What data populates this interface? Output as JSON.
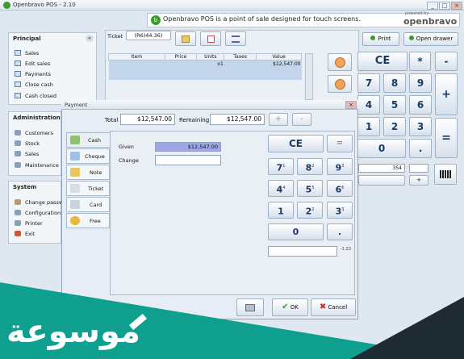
{
  "window": {
    "title": "Openbravo POS - 2.10",
    "min": "_",
    "max": "□",
    "close": "×"
  },
  "banner": {
    "text": "Openbravo POS is a point of sale designed for touch screens.",
    "powered": "powered by",
    "brand": "openbravo"
  },
  "principal": {
    "header": "Principal",
    "items": [
      "Sales",
      "Edit sales",
      "Payments",
      "Close cash",
      "Cash closed"
    ]
  },
  "administration": {
    "header": "Administration",
    "items": [
      "Customers",
      "Stock",
      "Sales",
      "Maintenance"
    ]
  },
  "system": {
    "header": "System",
    "items": [
      "Change passw",
      "Configuration",
      "Printer",
      "Exit"
    ]
  },
  "ticket": {
    "label": "Ticket",
    "number": "(R6)44.36)",
    "columns": [
      "Item",
      "Price",
      "Units",
      "Taxes",
      "Value"
    ],
    "rows": [
      {
        "item": "",
        "price": "",
        "units": "x1",
        "taxes": "",
        "value": "$12,547.00"
      }
    ]
  },
  "top_buttons": {
    "print": "Print",
    "open_drawer": "Open drawer"
  },
  "main_keypad": {
    "ce": "CE",
    "star": "*",
    "minus": "-",
    "plus": "+",
    "equals": "=",
    "dot": ".",
    "digits": [
      "7",
      "8",
      "9",
      "4",
      "5",
      "6",
      "1",
      "2",
      "3",
      "0"
    ]
  },
  "bg_field": "354",
  "dialog": {
    "title": "Payment",
    "total_label": "Total",
    "total_value": "$12,547.00",
    "remaining_label": "Remaining",
    "remaining_value": "$12,547.00",
    "add": "+",
    "remove": "-",
    "tabs": [
      "Cash",
      "Cheque",
      "Note",
      "Ticket",
      "Card",
      "Free"
    ],
    "given_label": "Given",
    "given_value": "$12,547.00",
    "change_label": "Change",
    "change_value": "",
    "keypad": {
      "ce": "CE",
      "equals": "=",
      "dot": ".",
      "keys": [
        {
          "digit": "7",
          "sup": "1"
        },
        {
          "digit": "8",
          "sup": "2"
        },
        {
          "digit": "9",
          "sup": "3"
        },
        {
          "digit": "4",
          "sup": "4"
        },
        {
          "digit": "5",
          "sup": "5"
        },
        {
          "digit": "6",
          "sup": "6"
        },
        {
          "digit": "1",
          "sup": ""
        },
        {
          "digit": "2",
          "sup": "2"
        },
        {
          "digit": "3",
          "sup": "3"
        },
        {
          "digit": "0",
          "sup": ""
        }
      ],
      "input_hint": "-1.23"
    },
    "ok": "OK",
    "cancel": "Cancel"
  },
  "watermark": {
    "text": "موسوعة"
  },
  "colors": {
    "accent_green": "#3d9b2e",
    "given_field": "#9fa6e6",
    "teal": "#0f9f8f",
    "dark": "#1e2b33"
  }
}
